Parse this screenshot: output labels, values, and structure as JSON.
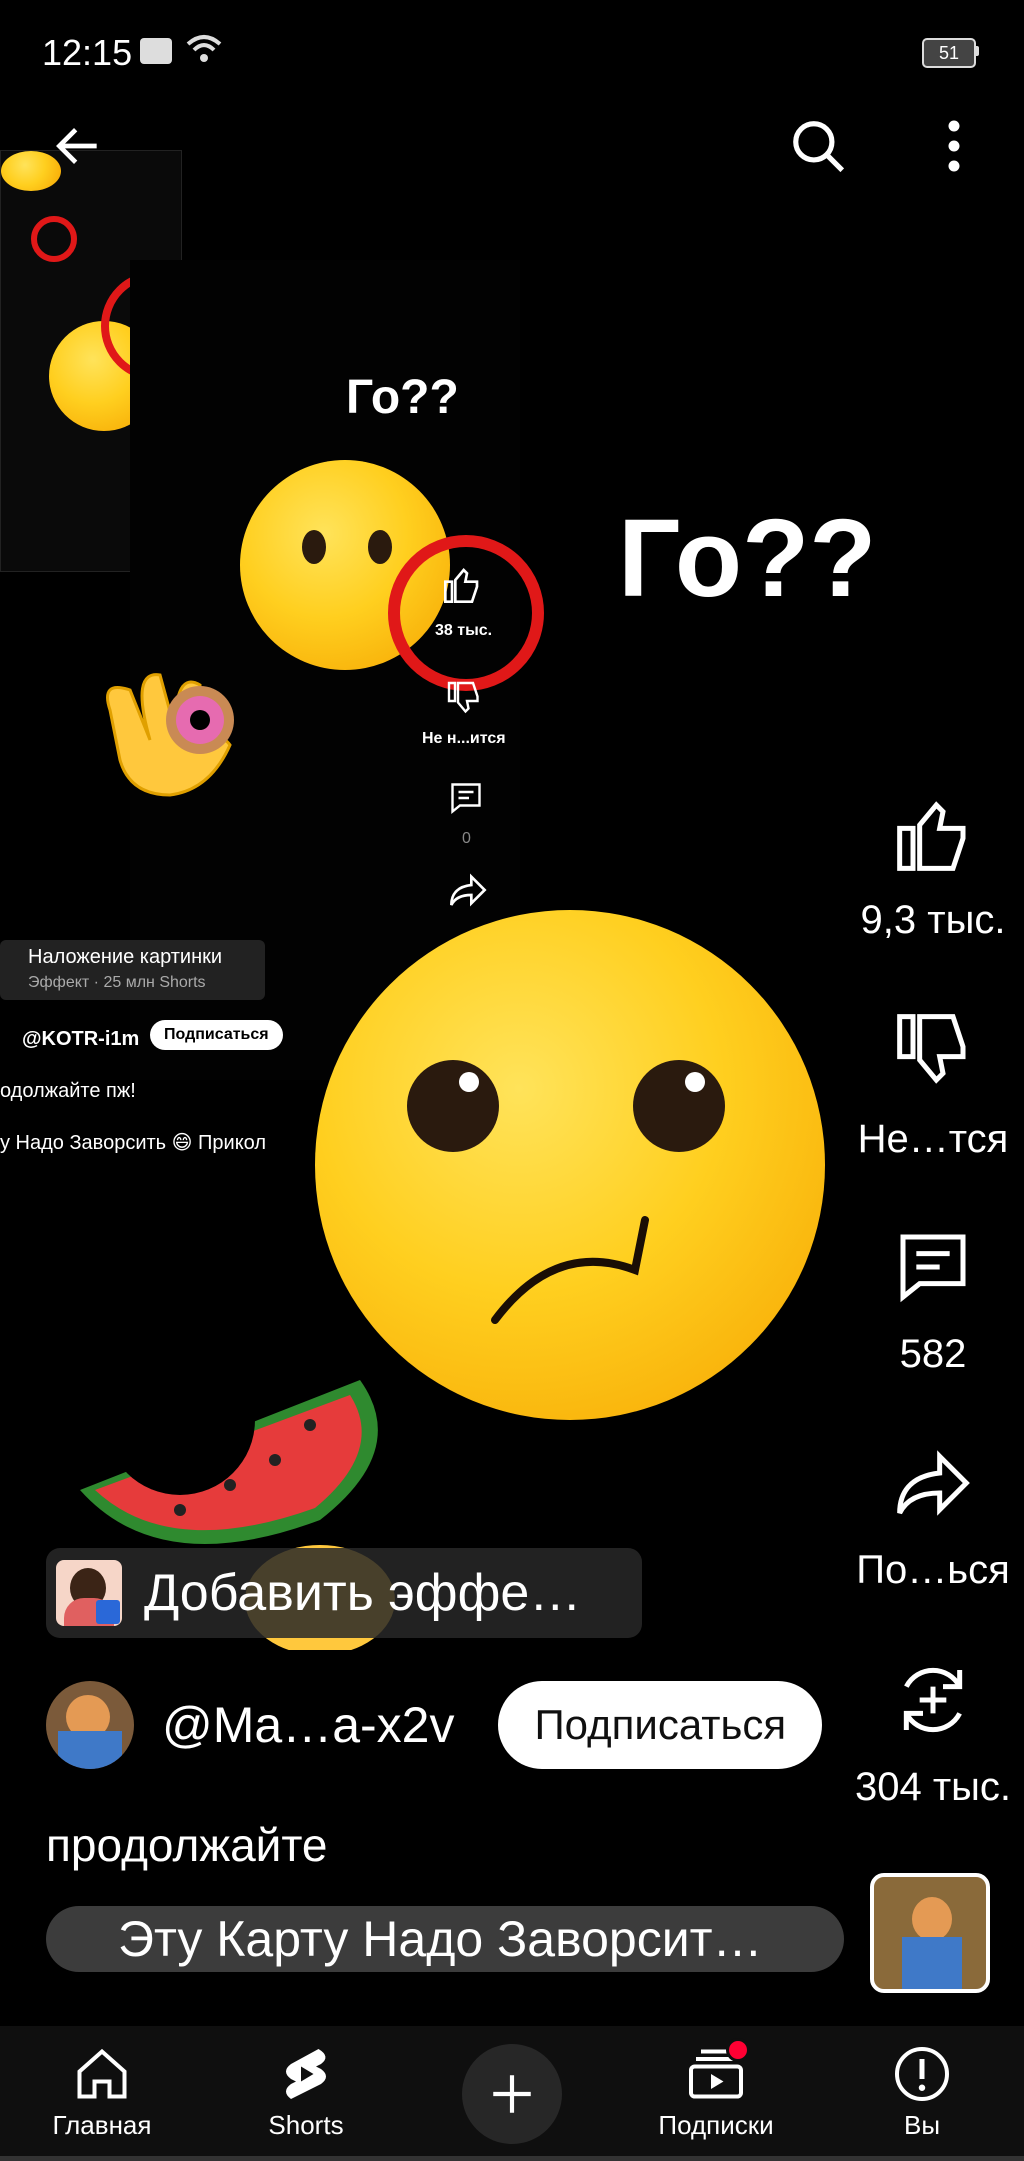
{
  "status_bar": {
    "time": "12:15",
    "battery": "51"
  },
  "video": {
    "big_text_1": "Го??",
    "big_text_2": "Го??",
    "nested_like_count": "38 тыс.",
    "nested_dislike_label": "Не н...ится",
    "nested_comments_count": "0",
    "nested_effect_title": "Наложение картинки",
    "nested_effect_sub": "Эффект · 25 млн Shorts",
    "nested_channel": "@KOTR-i1m",
    "nested_subscribe": "Подписаться",
    "nested_caption": "одолжайте пж!",
    "nested_music": "у Надо Заворсить 😄 Прикол"
  },
  "actions": {
    "like_count": "9,3 тыс.",
    "dislike_label": "Не…тся",
    "comments_count": "582",
    "share_label": "По…ься",
    "remix_count": "304 тыс."
  },
  "effect": {
    "label": "Добавить эффе…"
  },
  "channel": {
    "name": "@Ma…a-x2v",
    "subscribe": "Подписаться"
  },
  "caption": "продолжайте",
  "music": {
    "title": "Эту Карту Надо Заворсит…"
  },
  "nav": {
    "home": "Главная",
    "shorts": "Shorts",
    "subscriptions": "Подписки",
    "you": "Вы"
  },
  "colors": {
    "accent_red": "#e01818",
    "notify_dot": "#ff0033",
    "background": "#000000"
  }
}
